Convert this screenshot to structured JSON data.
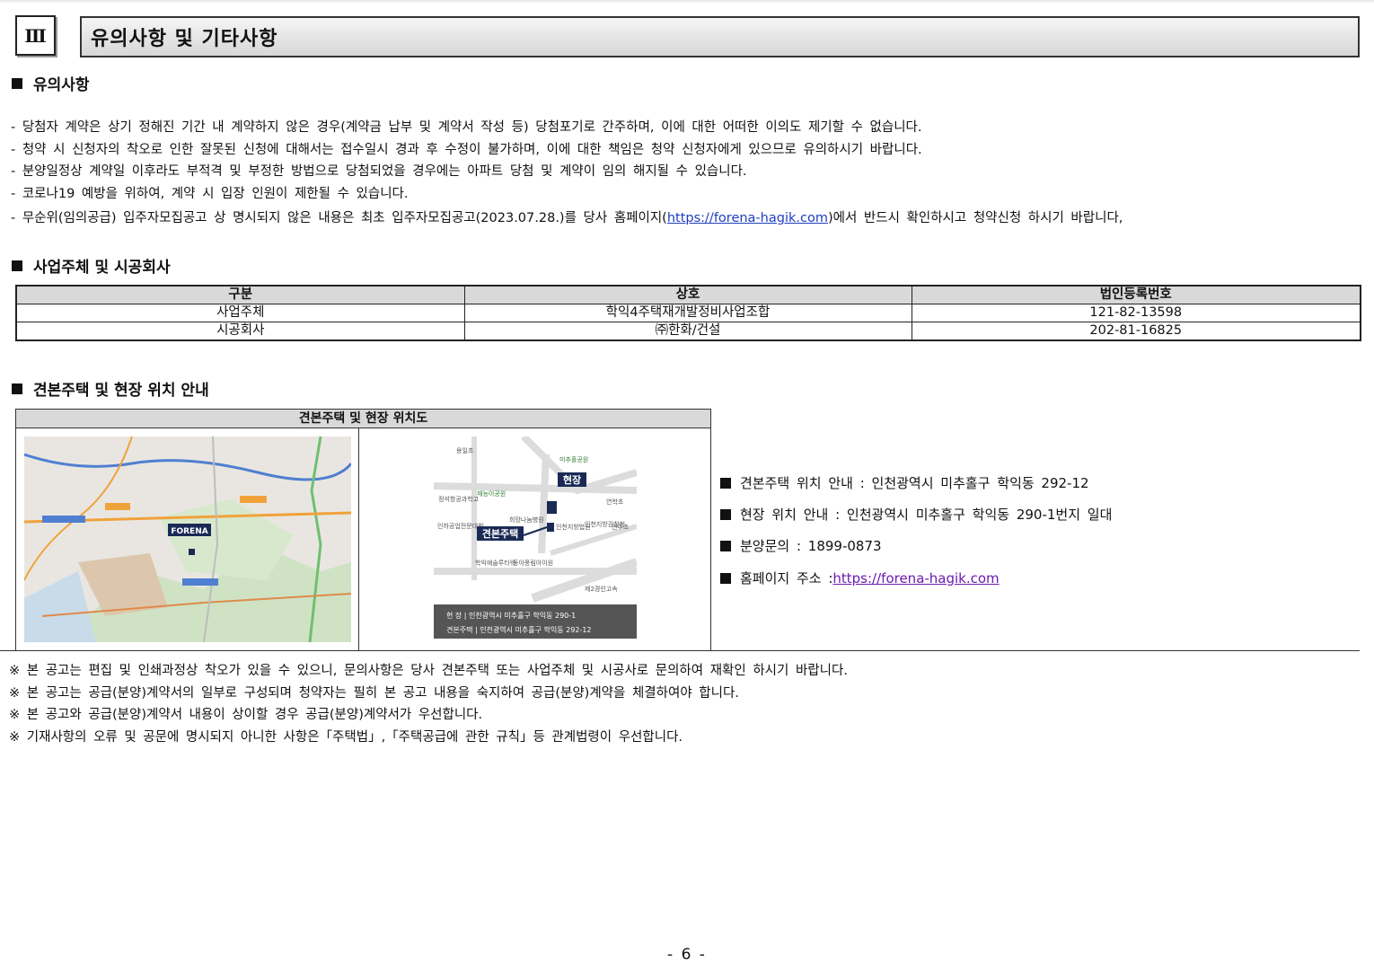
{
  "header": {
    "number": "Ⅲ",
    "title": "유의사항 및 기타사항"
  },
  "sections": {
    "notice_title": "유의사항",
    "company_title": "사업주체 및 시공회사",
    "location_title": "견본주택 및 현장 위치 안내"
  },
  "notices": [
    "- 당첨자 계약은 상기 정해진 기간 내 계약하지 않은 경우(계약금 납부 및 계약서 작성 등) 당첨포기로 간주하며, 이에 대한 어떠한 이의도 제기할 수 없습니다.",
    "- 청약 시 신청자의 착오로 인한 잘못된 신청에 대해서는 접수일시 경과 후 수정이 불가하며, 이에 대한 책임은 청약 신청자에게 있으므로 유의하시기 바랍니다.",
    "- 분양일정상 계약일 이후라도 부적격 및 부정한 방법으로 당첨되었을 경우에는 아파트 당첨 및 계약이 임의 해지될 수 있습니다.",
    "- 코로나19 예방을 위하여, 계약 시 입장 인원이 제한될 수 있습니다."
  ],
  "notice_last": {
    "before": "- 무순위(임의공급) 입주자모집공고 상 명시되지 않은 내용은 최초 입주자모집공고(2023.07.28.)를 당사 홈페이지(",
    "link": "https://forena-hagik.com",
    "after": ")에서 반드시 확인하시고 청약신청 하시기 바랍니다,"
  },
  "company_table": {
    "headers": [
      "구분",
      "상호",
      "법인등록번호"
    ],
    "rows": [
      [
        "사업주체",
        "학익4주택재개발정비사업조합",
        "121-82-13598"
      ],
      [
        "시공회사",
        "㈜한화/건설",
        "202-81-16825"
      ]
    ]
  },
  "map": {
    "header": "견본주택 및 현장 위치도",
    "left_map": {
      "brand": "FORENA"
    },
    "right_map": {
      "site_label": "현장",
      "model_label": "견본주택",
      "places": [
        "용일초",
        "미추홀공원",
        "정석항공과학고",
        "재능이공원",
        "연학초",
        "희망나눔병원",
        "인천지방법원",
        "인천지방검찰청",
        "인주초",
        "인하공업전문대학",
        "학익예술루타워",
        "동아풍림아이원",
        "제2경인고속"
      ],
      "legend_site": "현      장 | 인천광역시 미추홀구 학익동 290-1",
      "legend_model": "견본주택 | 인천광역시 미추홀구 학익동 292-12"
    }
  },
  "info": {
    "model_house": "견본주택 위치 안내 : 인천광역시 미추홀구 학익동 292-12",
    "site": "현장 위치 안내 : 인천광역시 미추홀구 학익동 290-1번지 일대",
    "inquiry": "분양문의 : 1899-0873",
    "homepage_label": "홈페이지 주소 : ",
    "homepage_url": "https://forena-hagik.com"
  },
  "footnotes": [
    "※ 본 공고는 편집 및 인쇄과정상 착오가 있을 수 있으니, 문의사항은 당사 견본주택 또는 사업주체 및 시공사로 문의하여 재확인 하시기 바랍니다.",
    "※ 본 공고는 공급(분양)계약서의 일부로 구성되며 청약자는 필히 본 공고 내용을 숙지하여 공급(분양)계약을 체결하여야 합니다.",
    "※ 본 공고와 공급(분양)계약서 내용이 상이할 경우 공급(분양)계약서가 우선합니다.",
    "※ 기재사항의 오류 및 공문에 명시되지 아니한 사항은「주택법」,「주택공급에 관한 규칙」등 관계법령이 우선합니다."
  ],
  "page_number": "- 6 -",
  "colors": {
    "link": "#1f3fbf",
    "visited_link": "#6a1bb0",
    "map_navy": "#1a2a55"
  }
}
